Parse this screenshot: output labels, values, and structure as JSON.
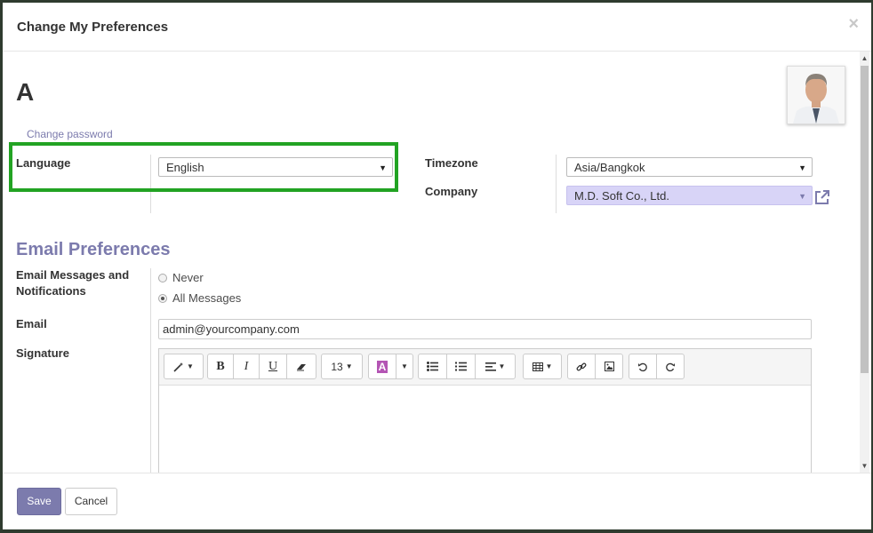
{
  "dialog": {
    "title": "Change My Preferences",
    "close_symbol": "×"
  },
  "user": {
    "name_partial": "A",
    "change_password": "Change password"
  },
  "fields": {
    "language": {
      "label": "Language",
      "value": "English"
    },
    "timezone": {
      "label": "Timezone",
      "value": "Asia/Bangkok"
    },
    "company": {
      "label": "Company",
      "value": "M.D. Soft Co., Ltd."
    }
  },
  "email_prefs": {
    "title": "Email Preferences",
    "notifications_label_line1": "Email Messages and",
    "notifications_label_line2": "Notifications",
    "options": [
      "Never",
      "All Messages"
    ],
    "selected": "All Messages",
    "email_label": "Email",
    "email_value": "admin@yourcompany.com",
    "signature_label": "Signature"
  },
  "editor_toolbar": {
    "bold": "B",
    "italic": "I",
    "underline": "U",
    "font_size": "13",
    "font_color_letter": "A"
  },
  "footer": {
    "save": "Save",
    "cancel": "Cancel"
  },
  "colors": {
    "accent": "#7c7bad",
    "highlight": "#22a323",
    "company_bg": "#d8d4f7"
  }
}
